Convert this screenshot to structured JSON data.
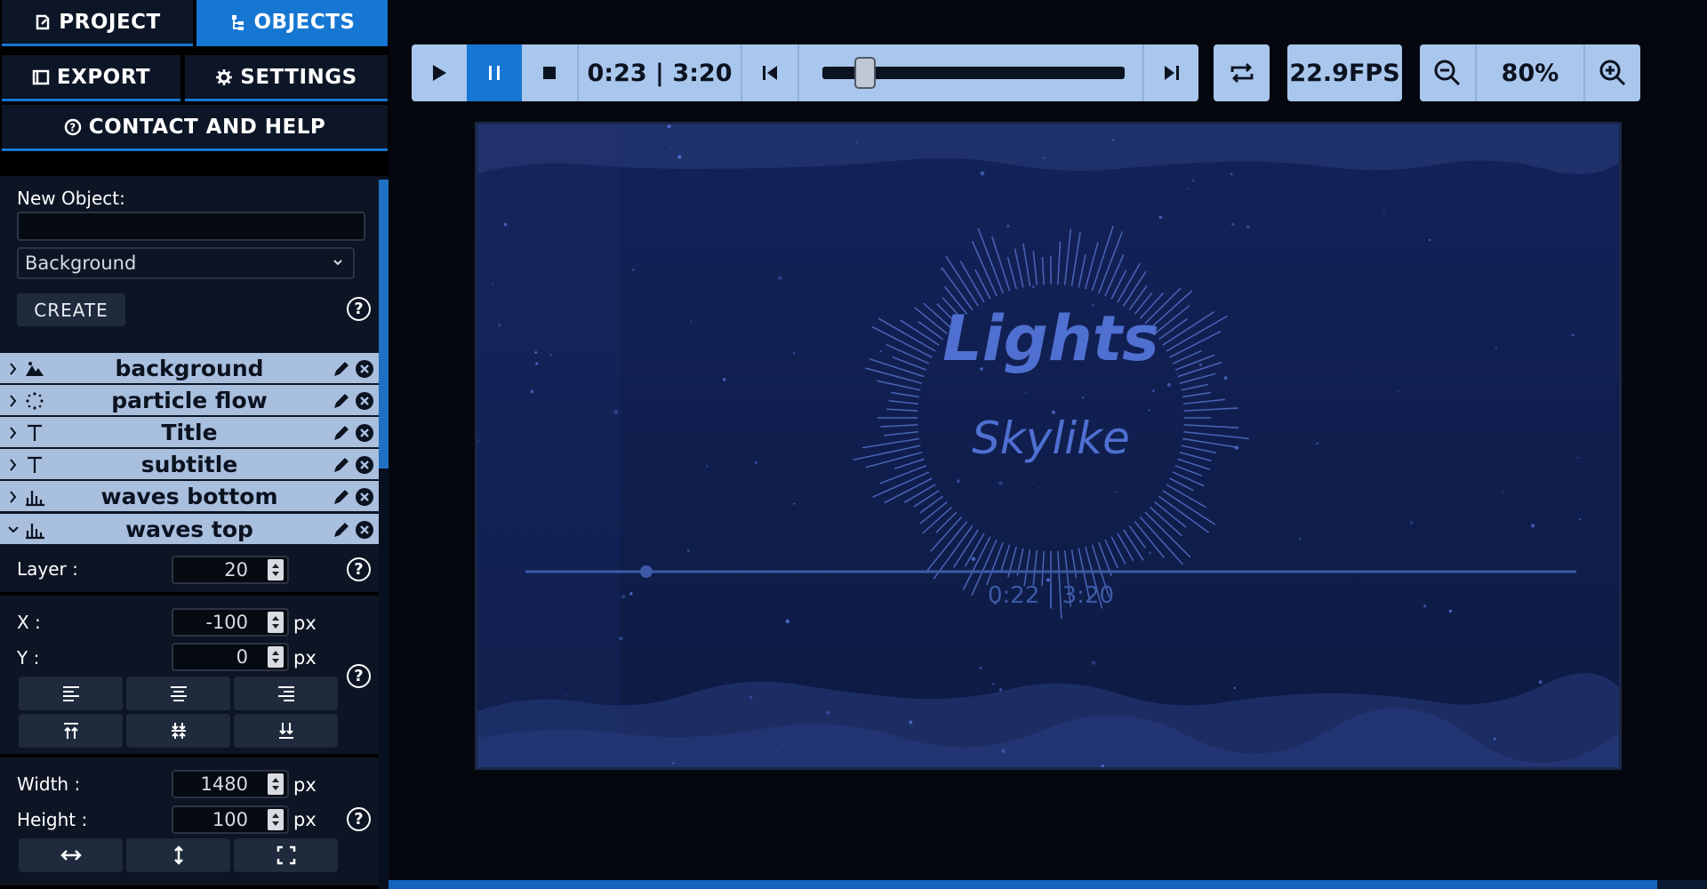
{
  "tabs": {
    "project": "PROJECT",
    "objects": "OBJECTS",
    "export": "EXPORT",
    "settings": "SETTINGS",
    "contact": "CONTACT AND HELP"
  },
  "new_object": {
    "label": "New Object:",
    "name_value": "",
    "type_selected": "Background",
    "create_label": "CREATE",
    "help": "?"
  },
  "objects": [
    {
      "name": "background",
      "icon": "mountain-icon",
      "expanded": false
    },
    {
      "name": "particle flow",
      "icon": "particles-icon",
      "expanded": false
    },
    {
      "name": "Title",
      "icon": "text-icon",
      "expanded": false
    },
    {
      "name": "subtitle",
      "icon": "text-icon",
      "expanded": false
    },
    {
      "name": "waves bottom",
      "icon": "bars-icon",
      "expanded": false
    },
    {
      "name": "waves top",
      "icon": "bars-icon",
      "expanded": true
    }
  ],
  "props": {
    "layer_label": "Layer :",
    "layer_value": "20",
    "x_label": "X :",
    "x_value": "-100",
    "y_label": "Y :",
    "y_value": "0",
    "width_label": "Width :",
    "width_value": "1480",
    "height_label": "Height :",
    "height_value": "100",
    "unit": "px",
    "help": "?"
  },
  "toolbar": {
    "time": "0:23 | 3:20",
    "fps": "22.9FPS",
    "zoom": "80%",
    "progress": 0.115,
    "playing": true
  },
  "preview": {
    "title": "Lights",
    "subtitle": "Skylike",
    "time": "0:22 | 3:20",
    "progress": 0.115
  },
  "colors": {
    "accent": "#1677d2",
    "row_bg": "#a9bfde",
    "toolbar_bg": "#a9c6ec",
    "preview_bg": "#0f1d47",
    "title_color": "#4f6fd1"
  }
}
